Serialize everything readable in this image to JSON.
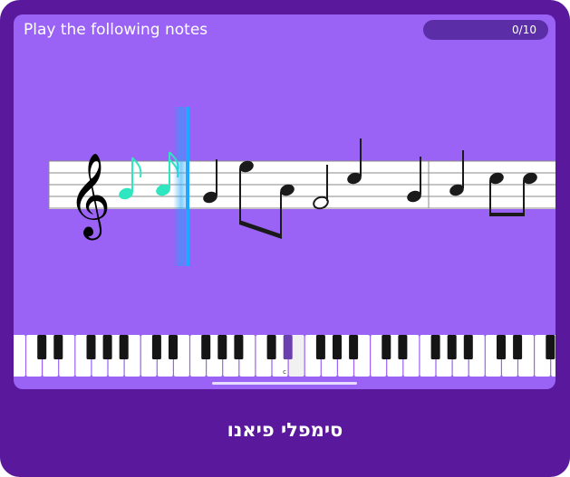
{
  "game": {
    "instruction": "Play the following notes",
    "progress_text": "0/10",
    "progress_fraction": 0,
    "middle_c_label": "c"
  },
  "footer": {
    "app_name": "סימפלי פיאנו"
  },
  "colors": {
    "frame": "#5a189d",
    "screen": "#9a62f5",
    "played_note": "#2ee6c0",
    "cursor": "#1fa8ff",
    "pending_note": "#1a1a1a"
  },
  "icons": {
    "clef": "treble-clef-icon"
  }
}
